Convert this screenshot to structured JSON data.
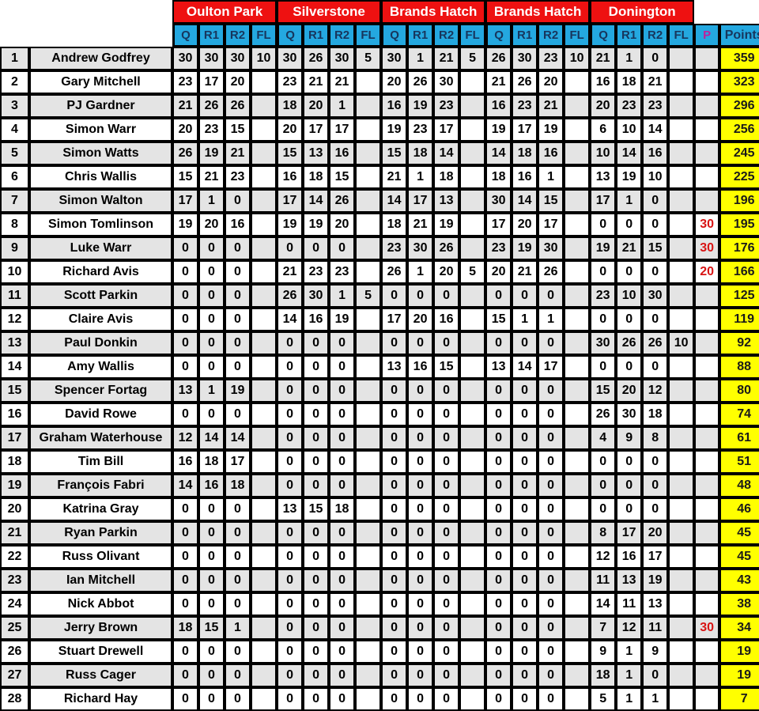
{
  "table": {
    "rank_header": "",
    "name_header": "",
    "points_header": "Points",
    "penalty_header": "P",
    "venues": [
      {
        "name": "Oulton Park"
      },
      {
        "name": "Silverstone"
      },
      {
        "name": "Brands Hatch"
      },
      {
        "name": "Brands Hatch"
      },
      {
        "name": "Donington"
      }
    ],
    "session_headers": [
      "Q",
      "R1",
      "R2",
      "FL"
    ],
    "colors": {
      "venue_band": "#ee1111",
      "session_band": "#24a8e0",
      "points_cell": "#ffff00",
      "penalty_text": "#d81414",
      "penalty_header_text": "#c0219c",
      "row_shaded": "#e4e4e4",
      "row_plain": "#ffffff"
    },
    "rows": [
      {
        "rank": "1",
        "name": "Andrew Godfrey",
        "scores": [
          "30",
          "30",
          "30",
          "10",
          "30",
          "26",
          "30",
          "5",
          "30",
          "1",
          "21",
          "5",
          "26",
          "30",
          "23",
          "10",
          "21",
          "1",
          "0",
          "",
          ""
        ],
        "penalty": "",
        "points": "359"
      },
      {
        "rank": "2",
        "name": "Gary Mitchell",
        "scores": [
          "23",
          "17",
          "20",
          "",
          "23",
          "21",
          "21",
          "",
          "20",
          "26",
          "30",
          "",
          "21",
          "26",
          "20",
          "",
          "16",
          "18",
          "21",
          "",
          ""
        ],
        "penalty": "",
        "points": "323"
      },
      {
        "rank": "3",
        "name": "PJ Gardner",
        "scores": [
          "21",
          "26",
          "26",
          "",
          "18",
          "20",
          "1",
          "",
          "16",
          "19",
          "23",
          "",
          "16",
          "23",
          "21",
          "",
          "20",
          "23",
          "23",
          "",
          ""
        ],
        "penalty": "",
        "points": "296"
      },
      {
        "rank": "4",
        "name": "Simon Warr",
        "scores": [
          "20",
          "23",
          "15",
          "",
          "20",
          "17",
          "17",
          "",
          "19",
          "23",
          "17",
          "",
          "19",
          "17",
          "19",
          "",
          "6",
          "10",
          "14",
          "",
          ""
        ],
        "penalty": "",
        "points": "256"
      },
      {
        "rank": "5",
        "name": "Simon Watts",
        "scores": [
          "26",
          "19",
          "21",
          "",
          "15",
          "13",
          "16",
          "",
          "15",
          "18",
          "14",
          "",
          "14",
          "18",
          "16",
          "",
          "10",
          "14",
          "16",
          "",
          ""
        ],
        "penalty": "",
        "points": "245"
      },
      {
        "rank": "6",
        "name": "Chris Wallis",
        "scores": [
          "15",
          "21",
          "23",
          "",
          "16",
          "18",
          "15",
          "",
          "21",
          "1",
          "18",
          "",
          "18",
          "16",
          "1",
          "",
          "13",
          "19",
          "10",
          "",
          ""
        ],
        "penalty": "",
        "points": "225"
      },
      {
        "rank": "7",
        "name": "Simon Walton",
        "scores": [
          "17",
          "1",
          "0",
          "",
          "17",
          "14",
          "26",
          "",
          "14",
          "17",
          "13",
          "",
          "30",
          "14",
          "15",
          "",
          "17",
          "1",
          "0",
          "",
          ""
        ],
        "penalty": "",
        "points": "196"
      },
      {
        "rank": "8",
        "name": "Simon Tomlinson",
        "scores": [
          "19",
          "20",
          "16",
          "",
          "19",
          "19",
          "20",
          "",
          "18",
          "21",
          "19",
          "",
          "17",
          "20",
          "17",
          "",
          "0",
          "0",
          "0",
          "",
          ""
        ],
        "penalty": "30",
        "points": "195"
      },
      {
        "rank": "9",
        "name": "Luke Warr",
        "scores": [
          "0",
          "0",
          "0",
          "",
          "0",
          "0",
          "0",
          "",
          "23",
          "30",
          "26",
          "",
          "23",
          "19",
          "30",
          "",
          "19",
          "21",
          "15",
          "",
          ""
        ],
        "penalty": "30",
        "points": "176"
      },
      {
        "rank": "10",
        "name": "Richard Avis",
        "scores": [
          "0",
          "0",
          "0",
          "",
          "21",
          "23",
          "23",
          "",
          "26",
          "1",
          "20",
          "5",
          "20",
          "21",
          "26",
          "",
          "0",
          "0",
          "0",
          "",
          ""
        ],
        "penalty": "20",
        "points": "166"
      },
      {
        "rank": "11",
        "name": "Scott Parkin",
        "scores": [
          "0",
          "0",
          "0",
          "",
          "26",
          "30",
          "1",
          "5",
          "0",
          "0",
          "0",
          "",
          "0",
          "0",
          "0",
          "",
          "23",
          "10",
          "30",
          "",
          ""
        ],
        "penalty": "",
        "points": "125"
      },
      {
        "rank": "12",
        "name": "Claire Avis",
        "scores": [
          "0",
          "0",
          "0",
          "",
          "14",
          "16",
          "19",
          "",
          "17",
          "20",
          "16",
          "",
          "15",
          "1",
          "1",
          "",
          "0",
          "0",
          "0",
          "",
          ""
        ],
        "penalty": "",
        "points": "119"
      },
      {
        "rank": "13",
        "name": "Paul Donkin",
        "scores": [
          "0",
          "0",
          "0",
          "",
          "0",
          "0",
          "0",
          "",
          "0",
          "0",
          "0",
          "",
          "0",
          "0",
          "0",
          "",
          "30",
          "26",
          "26",
          "10",
          ""
        ],
        "penalty": "",
        "points": "92"
      },
      {
        "rank": "14",
        "name": "Amy Wallis",
        "scores": [
          "0",
          "0",
          "0",
          "",
          "0",
          "0",
          "0",
          "",
          "13",
          "16",
          "15",
          "",
          "13",
          "14",
          "17",
          "",
          "0",
          "0",
          "0",
          "",
          ""
        ],
        "penalty": "",
        "points": "88"
      },
      {
        "rank": "15",
        "name": "Spencer Fortag",
        "scores": [
          "13",
          "1",
          "19",
          "",
          "0",
          "0",
          "0",
          "",
          "0",
          "0",
          "0",
          "",
          "0",
          "0",
          "0",
          "",
          "15",
          "20",
          "12",
          "",
          ""
        ],
        "penalty": "",
        "points": "80"
      },
      {
        "rank": "16",
        "name": "David Rowe",
        "scores": [
          "0",
          "0",
          "0",
          "",
          "0",
          "0",
          "0",
          "",
          "0",
          "0",
          "0",
          "",
          "0",
          "0",
          "0",
          "",
          "26",
          "30",
          "18",
          "",
          ""
        ],
        "penalty": "",
        "points": "74"
      },
      {
        "rank": "17",
        "name": "Graham Waterhouse",
        "scores": [
          "12",
          "14",
          "14",
          "",
          "0",
          "0",
          "0",
          "",
          "0",
          "0",
          "0",
          "",
          "0",
          "0",
          "0",
          "",
          "4",
          "9",
          "8",
          "",
          ""
        ],
        "penalty": "",
        "points": "61"
      },
      {
        "rank": "18",
        "name": "Tim Bill",
        "scores": [
          "16",
          "18",
          "17",
          "",
          "0",
          "0",
          "0",
          "",
          "0",
          "0",
          "0",
          "",
          "0",
          "0",
          "0",
          "",
          "0",
          "0",
          "0",
          "",
          ""
        ],
        "penalty": "",
        "points": "51"
      },
      {
        "rank": "19",
        "name": "François Fabri",
        "scores": [
          "14",
          "16",
          "18",
          "",
          "0",
          "0",
          "0",
          "",
          "0",
          "0",
          "0",
          "",
          "0",
          "0",
          "0",
          "",
          "0",
          "0",
          "0",
          "",
          ""
        ],
        "penalty": "",
        "points": "48"
      },
      {
        "rank": "20",
        "name": "Katrina Gray",
        "scores": [
          "0",
          "0",
          "0",
          "",
          "13",
          "15",
          "18",
          "",
          "0",
          "0",
          "0",
          "",
          "0",
          "0",
          "0",
          "",
          "0",
          "0",
          "0",
          "",
          ""
        ],
        "penalty": "",
        "points": "46"
      },
      {
        "rank": "21",
        "name": "Ryan Parkin",
        "scores": [
          "0",
          "0",
          "0",
          "",
          "0",
          "0",
          "0",
          "",
          "0",
          "0",
          "0",
          "",
          "0",
          "0",
          "0",
          "",
          "8",
          "17",
          "20",
          "",
          ""
        ],
        "penalty": "",
        "points": "45"
      },
      {
        "rank": "22",
        "name": "Russ Olivant",
        "scores": [
          "0",
          "0",
          "0",
          "",
          "0",
          "0",
          "0",
          "",
          "0",
          "0",
          "0",
          "",
          "0",
          "0",
          "0",
          "",
          "12",
          "16",
          "17",
          "",
          ""
        ],
        "penalty": "",
        "points": "45"
      },
      {
        "rank": "23",
        "name": "Ian Mitchell",
        "scores": [
          "0",
          "0",
          "0",
          "",
          "0",
          "0",
          "0",
          "",
          "0",
          "0",
          "0",
          "",
          "0",
          "0",
          "0",
          "",
          "11",
          "13",
          "19",
          "",
          ""
        ],
        "penalty": "",
        "points": "43"
      },
      {
        "rank": "24",
        "name": "Nick Abbot",
        "scores": [
          "0",
          "0",
          "0",
          "",
          "0",
          "0",
          "0",
          "",
          "0",
          "0",
          "0",
          "",
          "0",
          "0",
          "0",
          "",
          "14",
          "11",
          "13",
          "",
          ""
        ],
        "penalty": "",
        "points": "38"
      },
      {
        "rank": "25",
        "name": "Jerry Brown",
        "scores": [
          "18",
          "15",
          "1",
          "",
          "0",
          "0",
          "0",
          "",
          "0",
          "0",
          "0",
          "",
          "0",
          "0",
          "0",
          "",
          "7",
          "12",
          "11",
          "",
          ""
        ],
        "penalty": "30",
        "points": "34"
      },
      {
        "rank": "26",
        "name": "Stuart Drewell",
        "scores": [
          "0",
          "0",
          "0",
          "",
          "0",
          "0",
          "0",
          "",
          "0",
          "0",
          "0",
          "",
          "0",
          "0",
          "0",
          "",
          "9",
          "1",
          "9",
          "",
          ""
        ],
        "penalty": "",
        "points": "19"
      },
      {
        "rank": "27",
        "name": "Russ Cager",
        "scores": [
          "0",
          "0",
          "0",
          "",
          "0",
          "0",
          "0",
          "",
          "0",
          "0",
          "0",
          "",
          "0",
          "0",
          "0",
          "",
          "18",
          "1",
          "0",
          "",
          ""
        ],
        "penalty": "",
        "points": "19"
      },
      {
        "rank": "28",
        "name": "Richard Hay",
        "scores": [
          "0",
          "0",
          "0",
          "",
          "0",
          "0",
          "0",
          "",
          "0",
          "0",
          "0",
          "",
          "0",
          "0",
          "0",
          "",
          "5",
          "1",
          "1",
          "",
          ""
        ],
        "penalty": "",
        "points": "7"
      }
    ]
  }
}
